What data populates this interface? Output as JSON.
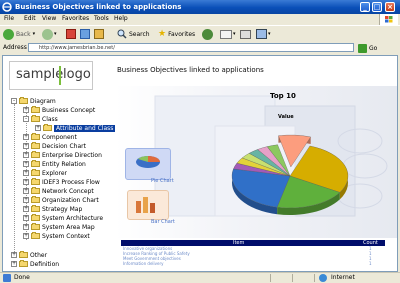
{
  "window": {
    "title": "Business Objectives linked to applications"
  },
  "menu": [
    "File",
    "Edit",
    "View",
    "Favorites",
    "Tools",
    "Help"
  ],
  "toolbar": {
    "back_label": "Back",
    "search_label": "Search",
    "favorites_label": "Favorites"
  },
  "address": {
    "label": "Address",
    "value": "http://www.jamesbrian.be.net/",
    "go_label": "Go"
  },
  "logo": {
    "part1": "sample",
    "part2": "logo"
  },
  "page": {
    "heading": "Business Objectives linked to applications"
  },
  "tree": {
    "root": "Diagram",
    "items": [
      "Business Concept",
      "Class",
      "Component",
      "Decision Chart",
      "Enterprise Direction",
      "Entity Relation",
      "Explorer",
      "IDEF3 Process Flow",
      "Network Concept",
      "Organization Chart",
      "Strategy Map",
      "System Architecture",
      "System Area Map",
      "System Context"
    ],
    "selected": "Attribute and Class",
    "other": [
      "Other",
      "Definition"
    ]
  },
  "chart": {
    "title": "Top 10",
    "value_label": "Value",
    "thumb_pie": "Pie Chart",
    "thumb_bar": "Bar Chart"
  },
  "chart_data": {
    "type": "pie",
    "title": "Top 10",
    "values": [
      28,
      20,
      25,
      3,
      3,
      3,
      3,
      3,
      3,
      9
    ],
    "colors": [
      "#d6ad00",
      "#5fb03c",
      "#3070c8",
      "#a35bb8",
      "#e3d23a",
      "#c8e070",
      "#67b4a4",
      "#e6a0c8",
      "#8cc85f",
      "#fc9d7e"
    ],
    "exploded_index": 9
  },
  "table": {
    "headers": [
      "Item",
      "Count"
    ],
    "rows": [
      [
        "Innovative organizations",
        "1"
      ],
      [
        "Increase Ranking of Public Safety",
        "1"
      ],
      [
        "Meet Government objectives",
        "1"
      ],
      [
        "Information delivery",
        "1"
      ]
    ]
  },
  "status": {
    "left": "Done",
    "zone": "Internet"
  },
  "colors": {
    "titlebar": "#0a4fb8",
    "tree_selected": "#0a3ea0",
    "table_header": "#000d6b"
  }
}
